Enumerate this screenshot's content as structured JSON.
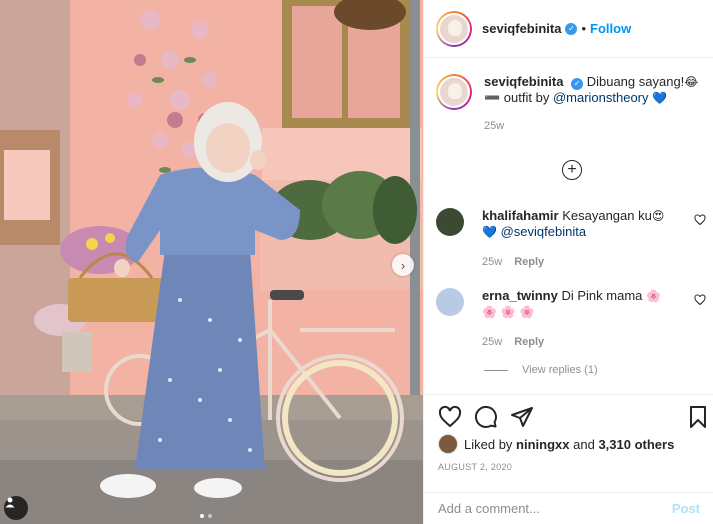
{
  "post": {
    "username": "seviqfebinita",
    "follow_label": "Follow",
    "dot": "•",
    "verified_symbol": "✓"
  },
  "caption": {
    "username": "seviqfebinita",
    "text": "Dibuang sayang!",
    "emoji_1": "😂",
    "line2_prefix": "➖ outfit by ",
    "mention": "@marionstheory",
    "emoji_2": "💙",
    "time": "25w"
  },
  "load_more_symbol": "+",
  "comments": [
    {
      "username": "khalifahamir",
      "text": "Kesayangan ku",
      "emoji": "😍",
      "line2_emoji": "💙",
      "mention": "@seviqfebinita",
      "time": "25w",
      "reply_label": "Reply"
    },
    {
      "username": "erna_twinny",
      "text": "Di Pink mama",
      "emoji": "🌸",
      "line2": "🌸 🌸 🌸",
      "time": "25w",
      "reply_label": "Reply"
    }
  ],
  "view_replies": "View replies (1)",
  "likes": {
    "prefix": "Liked by ",
    "user": "niningxx",
    "middle": " and ",
    "count": "3,310 others"
  },
  "date": "AUGUST 2, 2020",
  "add_comment": {
    "placeholder": "Add a comment...",
    "post_label": "Post"
  },
  "photo": {
    "next_arrow": "›"
  },
  "colors": {
    "accent": "#0095f6",
    "verified": "#3897f0",
    "wall_pink": "#f0ad9f",
    "dress_blue": "#6f86b8"
  }
}
